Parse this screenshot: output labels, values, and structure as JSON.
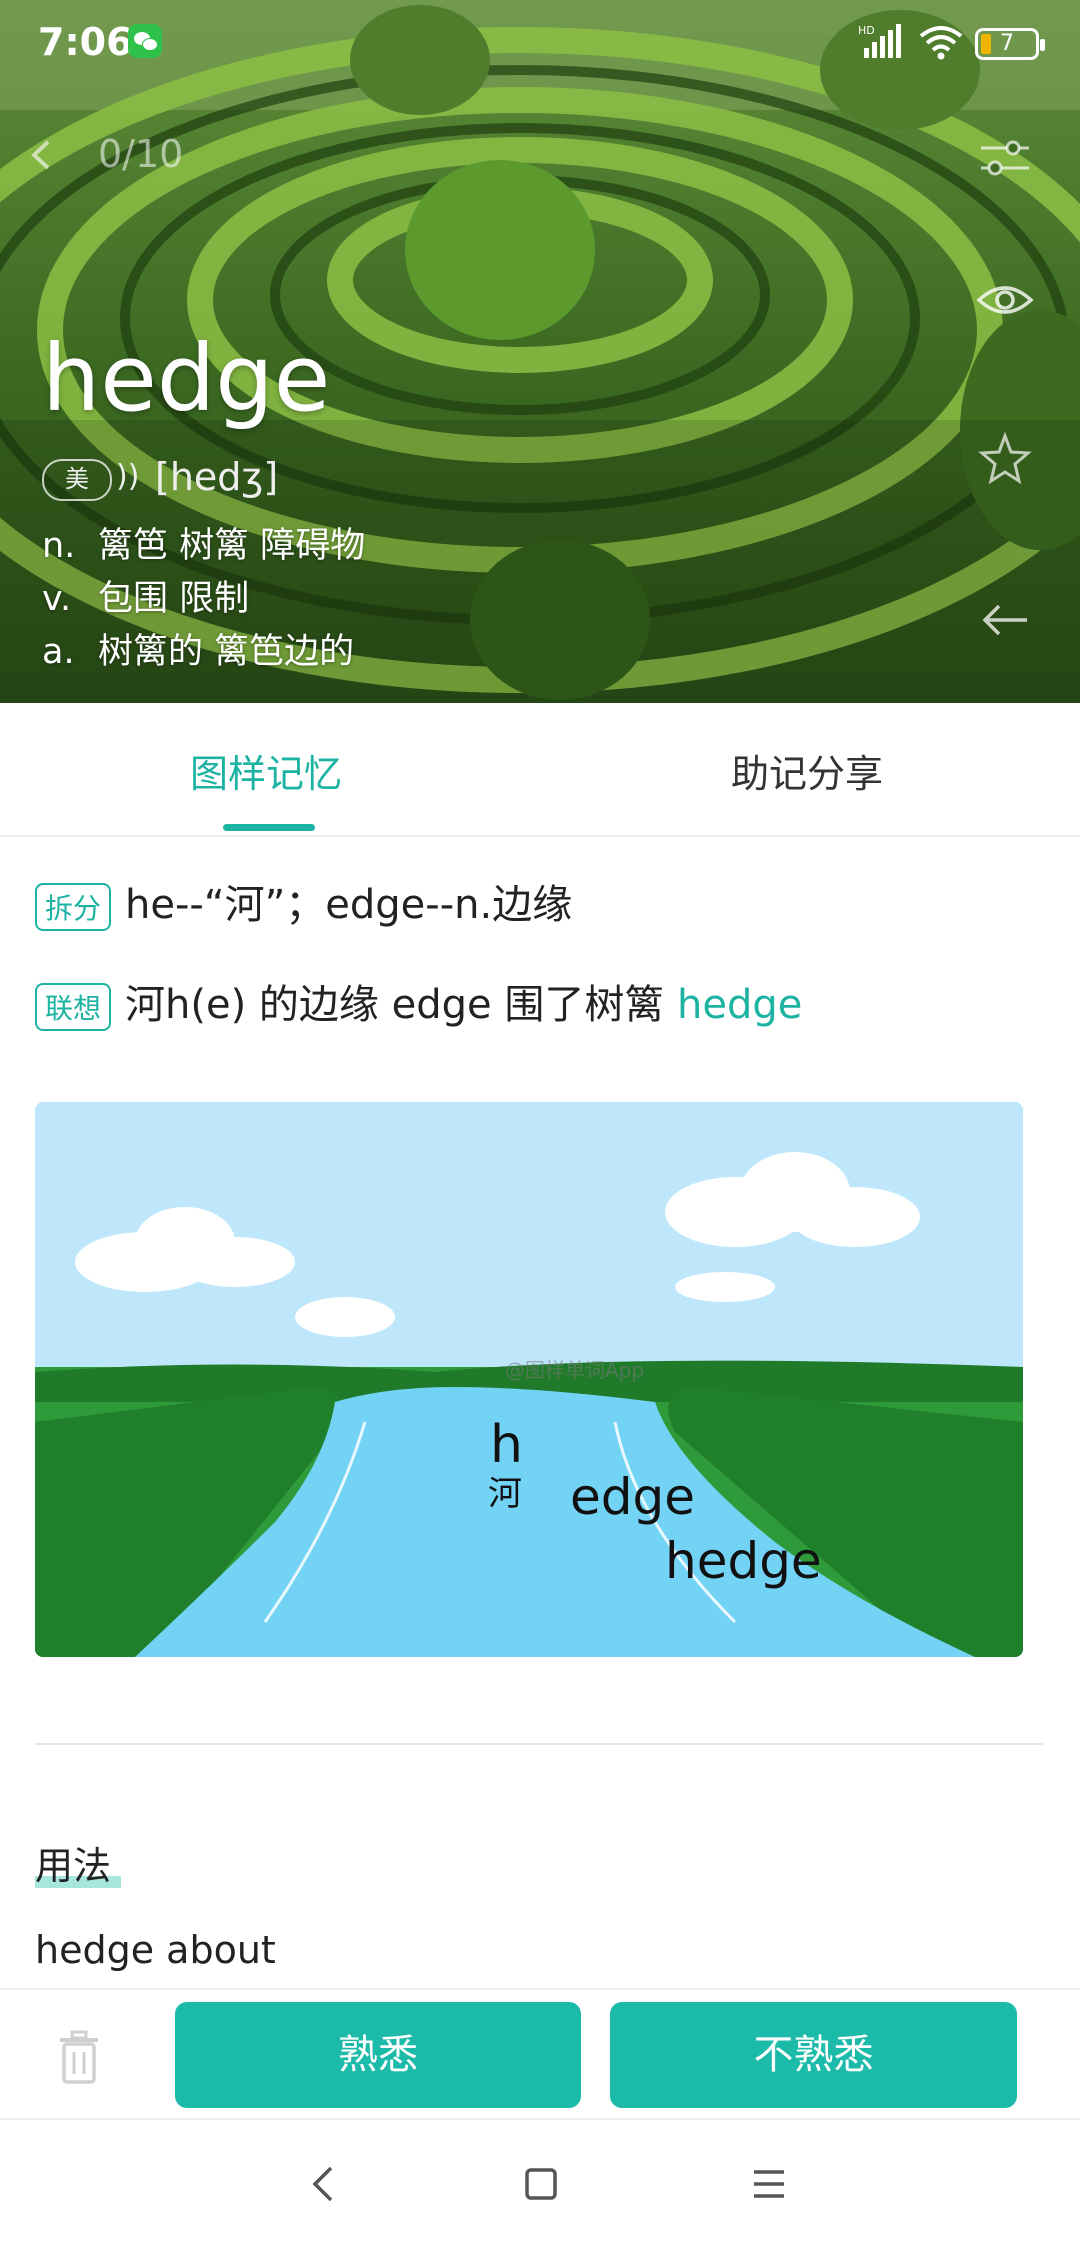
{
  "status": {
    "time": "7:06",
    "battery": "7",
    "signal_label": "HD"
  },
  "header": {
    "progress": "0/10"
  },
  "word": {
    "term": "hedge",
    "region_badge": "美",
    "phonetic": "[hedʒ]",
    "definitions": [
      {
        "pos": "n.",
        "text": "篱笆 树篱 障碍物"
      },
      {
        "pos": "v.",
        "text": "包围 限制"
      },
      {
        "pos": "a.",
        "text": "树篱的 篱笆边的"
      }
    ]
  },
  "tabs": [
    {
      "label": "图样记忆",
      "active": true
    },
    {
      "label": "助记分享",
      "active": false
    }
  ],
  "memory": {
    "split_tag": "拆分",
    "split_text": "he--“河”；edge--n.边缘",
    "assoc_tag": "联想",
    "assoc_text": "河h(e) 的边缘 edge 围了树篱 ",
    "assoc_highlight": "hedge"
  },
  "illustration": {
    "labels": [
      "h",
      "河",
      "edge",
      "hedge"
    ],
    "watermark": "@图样单词App"
  },
  "usage": {
    "title": "用法",
    "phrase": "hedge about"
  },
  "actions": {
    "familiar": "熟悉",
    "unfamiliar": "不熟悉"
  },
  "colors": {
    "accent": "#1cb3a3",
    "button": "#1cbaa8"
  }
}
